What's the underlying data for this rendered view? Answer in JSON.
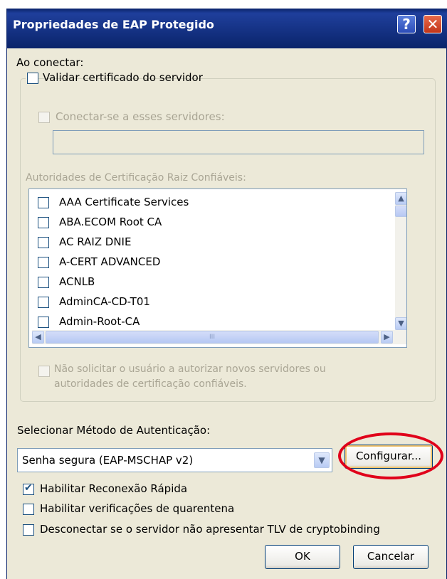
{
  "window": {
    "title": "Propriedades de EAP Protegido",
    "help_symbol": "?",
    "close_symbol": "✕"
  },
  "connect": {
    "section_label": "Ao conectar:",
    "validate_cert": {
      "label": "Validar certificado do servidor",
      "checked": false
    },
    "connect_servers": {
      "label": "Conectar-se a esses servidores:",
      "checked": false,
      "value": ""
    },
    "trusted_ca_label": "Autoridades de Certificação Raiz Confiáveis:",
    "ca_list": [
      {
        "name": "AAA Certificate Services",
        "checked": false
      },
      {
        "name": "ABA.ECOM Root CA",
        "checked": false
      },
      {
        "name": "AC RAIZ DNIE",
        "checked": false
      },
      {
        "name": "A-CERT ADVANCED",
        "checked": false
      },
      {
        "name": "ACNLB",
        "checked": false
      },
      {
        "name": "AdminCA-CD-T01",
        "checked": false
      },
      {
        "name": "Admin-Root-CA",
        "checked": false
      }
    ],
    "scroll": {
      "up": "▲",
      "down": "▼",
      "left": "◀",
      "right": "▶",
      "thumb_grip": "III"
    },
    "no_prompt": {
      "line1": "Não solicitar o usuário a autorizar novos servidores ou",
      "line2": "autoridades de certificação confiáveis.",
      "checked": false
    }
  },
  "auth": {
    "method_label": "Selecionar Método de Autenticação:",
    "method_value": "Senha segura (EAP-MSCHAP v2)",
    "configure_label": "Configurar..."
  },
  "options": [
    {
      "label": "Habilitar Reconexão Rápida",
      "checked": true
    },
    {
      "label": "Habilitar verificações de quarentena",
      "checked": false
    },
    {
      "label": "Desconectar se o servidor não apresentar TLV de cryptobinding",
      "checked": false
    }
  ],
  "buttons": {
    "ok": "OK",
    "cancel": "Cancelar"
  },
  "colors": {
    "titlebar": "#0a246a",
    "dialog_bg": "#ece9d8",
    "highlight_ring": "#e0001a",
    "disabled_text": "#a9a594"
  }
}
